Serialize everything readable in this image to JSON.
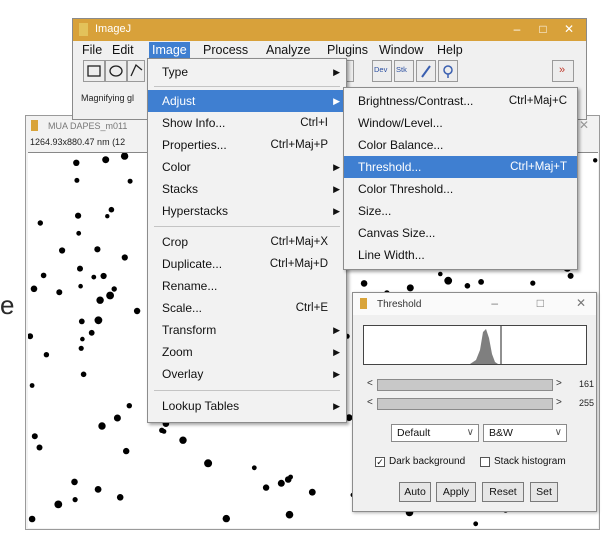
{
  "stray_text": "e",
  "imagej_window": {
    "title": "ImageJ",
    "window_controls": [
      "–",
      "□",
      "✕"
    ],
    "menu": [
      "File",
      "Edit",
      "Image",
      "Process",
      "Analyze",
      "Plugins",
      "Window",
      "Help"
    ],
    "active_menu": "Image",
    "toolbar_labels": {
      "dev": "Dev",
      "stk": "Stk",
      "more": "»"
    },
    "status": "Magnifying gl"
  },
  "image_window": {
    "title": "MUA DAPES_m011",
    "info": "1264.93x880.47 nm (12"
  },
  "image_menu": {
    "items": [
      {
        "label": "Type",
        "shortcut": "",
        "submenu": true
      },
      {
        "label": "Adjust",
        "shortcut": "",
        "submenu": true,
        "highlighted": true
      },
      {
        "label": "Show Info...",
        "shortcut": "Ctrl+I"
      },
      {
        "label": "Properties...",
        "shortcut": "Ctrl+Maj+P"
      },
      {
        "label": "Color",
        "shortcut": "",
        "submenu": true
      },
      {
        "label": "Stacks",
        "shortcut": "",
        "submenu": true
      },
      {
        "label": "Hyperstacks",
        "shortcut": "",
        "submenu": true
      },
      {
        "label": "Crop",
        "shortcut": "Ctrl+Maj+X"
      },
      {
        "label": "Duplicate...",
        "shortcut": "Ctrl+Maj+D"
      },
      {
        "label": "Rename...",
        "shortcut": ""
      },
      {
        "label": "Scale...",
        "shortcut": "Ctrl+E"
      },
      {
        "label": "Transform",
        "shortcut": "",
        "submenu": true
      },
      {
        "label": "Zoom",
        "shortcut": "",
        "submenu": true
      },
      {
        "label": "Overlay",
        "shortcut": "",
        "submenu": true
      },
      {
        "label": "Lookup Tables",
        "shortcut": "",
        "submenu": true
      }
    ]
  },
  "adjust_menu": {
    "items": [
      {
        "label": "Brightness/Contrast...",
        "shortcut": "Ctrl+Maj+C"
      },
      {
        "label": "Window/Level...",
        "shortcut": ""
      },
      {
        "label": "Color Balance...",
        "shortcut": ""
      },
      {
        "label": "Threshold...",
        "shortcut": "Ctrl+Maj+T",
        "highlighted": true
      },
      {
        "label": "Color Threshold...",
        "shortcut": ""
      },
      {
        "label": "Size...",
        "shortcut": ""
      },
      {
        "label": "Canvas Size...",
        "shortcut": ""
      },
      {
        "label": "Line Width...",
        "shortcut": ""
      }
    ]
  },
  "threshold_dialog": {
    "title": "Threshold",
    "window_controls": [
      "–",
      "□",
      "✕"
    ],
    "lower_value": "161",
    "upper_value": "255",
    "method": "Default",
    "display_mode": "B&W",
    "dark_background": {
      "label": "Dark background",
      "checked": true
    },
    "stack_histogram": {
      "label": "Stack histogram",
      "checked": false
    },
    "buttons": [
      "Auto",
      "Apply",
      "Reset",
      "Set"
    ]
  },
  "colors": {
    "menu_highlight": "#3f7fd1",
    "title_bar": "#d8a13a",
    "histogram_fill": "#7f7f7f"
  }
}
